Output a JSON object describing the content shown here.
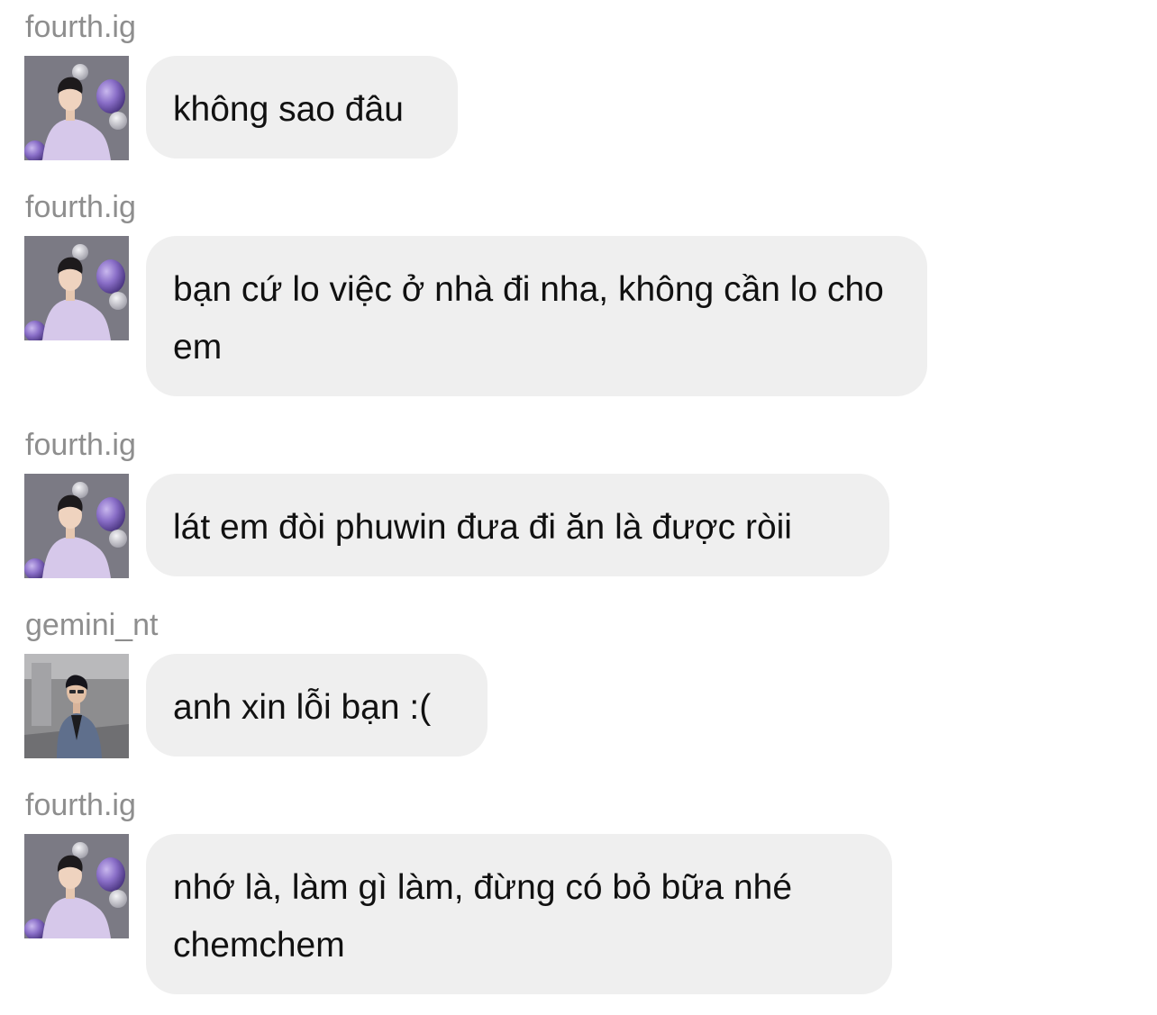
{
  "messages": [
    {
      "username": "fourth.ig",
      "text": "không sao đâu"
    },
    {
      "username": "fourth.ig",
      "text": "bạn cứ lo việc ở nhà đi nha, không cần lo cho em"
    },
    {
      "username": "fourth.ig",
      "text": "lát em đòi phuwin đưa đi ăn là được ròii"
    },
    {
      "username": "gemini_nt",
      "text": "anh xin lỗi bạn :("
    },
    {
      "username": "fourth.ig",
      "text": "nhớ là, làm gì làm, đừng có bỏ bữa nhé chemchem"
    }
  ]
}
